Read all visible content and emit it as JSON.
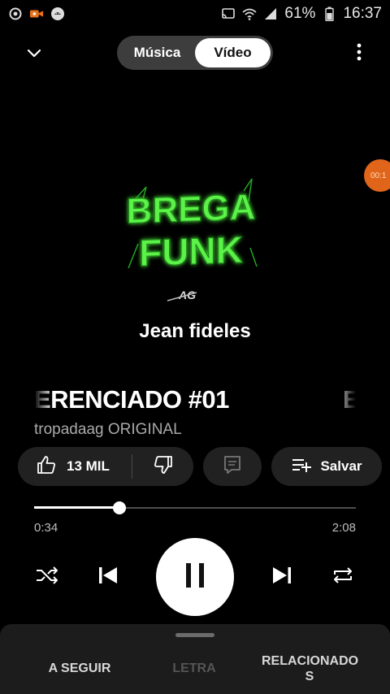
{
  "status_bar": {
    "battery": "61%",
    "time": "16:37",
    "left_icons": [
      "record-icon",
      "camera-icon",
      "android-icon"
    ],
    "right_icons": [
      "cast-icon",
      "wifi-icon",
      "signal-icon"
    ]
  },
  "top_bar": {
    "tabs": [
      {
        "label": "Música",
        "active": false
      },
      {
        "label": "Vídeo",
        "active": true
      }
    ]
  },
  "artwork": {
    "line1": "BREGA",
    "line2": "FUNK",
    "logo": "AG",
    "accent_color": "#4cff3a"
  },
  "floating_bubble": {
    "text": "00:1",
    "color": "#e0651a"
  },
  "video_overlay_title": "Jean fideles",
  "song": {
    "title_visible": "ERENCIADO #01",
    "title_repeat": "E",
    "artist": "tropadaag ORIGINAL"
  },
  "actions": {
    "like_count": "13 MIL",
    "save_label": "Salvar"
  },
  "progress": {
    "current": "0:34",
    "total": "2:08",
    "fraction": 0.266
  },
  "bottom_sheet": {
    "tabs": [
      {
        "label": "A SEGUIR",
        "enabled": true
      },
      {
        "label": "LETRA",
        "enabled": false
      },
      {
        "label": "RELACIONADO\nS",
        "line1": "RELACIONADO",
        "line2": "S",
        "enabled": true
      }
    ]
  }
}
